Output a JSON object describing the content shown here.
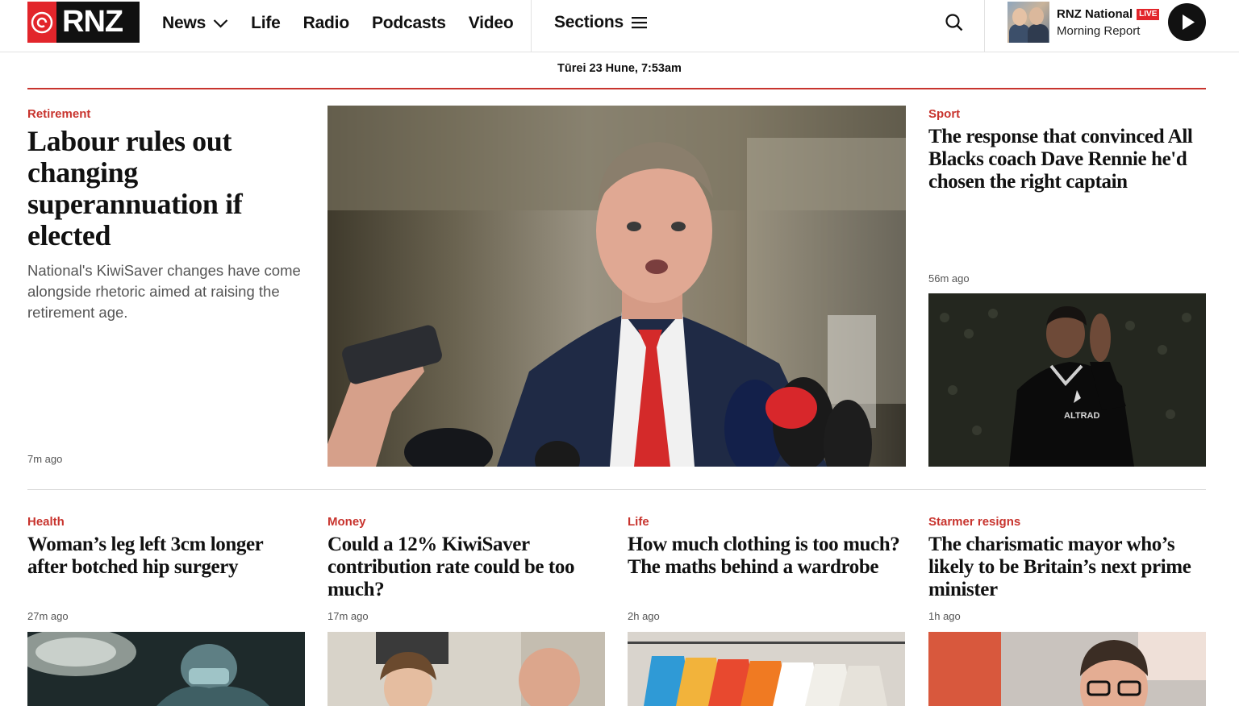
{
  "header": {
    "logo_text": "RNZ",
    "nav": [
      {
        "label": "News"
      },
      {
        "label": "Life"
      },
      {
        "label": "Radio"
      },
      {
        "label": "Podcasts"
      },
      {
        "label": "Video"
      }
    ],
    "sections_label": "Sections",
    "radio": {
      "station": "RNZ National",
      "live_badge": "LIVE",
      "show": "Morning Report"
    }
  },
  "date_line": "Tūrei 23 Hune, 7:53am",
  "lead_story": {
    "category": "Retirement",
    "headline": "Labour rules out changing superannuation if elected",
    "summary": "National's KiwiSaver changes have come alongside rhetoric aimed at raising the retirement age.",
    "time": "7m ago"
  },
  "side_story": {
    "category": "Sport",
    "headline": "The response that convinced All Blacks coach Dave Rennie he'd chosen the right captain",
    "time": "56m ago",
    "jersey_text": "ALTRAD"
  },
  "cards": [
    {
      "category": "Health",
      "headline": "Woman’s leg left 3cm longer after botched hip surgery",
      "time": "27m ago"
    },
    {
      "category": "Money",
      "headline": "Could a 12% KiwiSaver contribution rate could be too much?",
      "time": "17m ago"
    },
    {
      "category": "Life",
      "headline": "How much clothing is too much? The maths behind a wardrobe",
      "time": "2h ago"
    },
    {
      "category": "Starmer resigns",
      "headline": "The charismatic mayor who’s likely to be Britain’s next prime minister",
      "time": "1h ago"
    }
  ],
  "colors": {
    "accent_red": "#c8342e",
    "logo_red": "#e2252b",
    "text": "#111111",
    "muted": "#555555"
  },
  "icons": [
    "rnz-logo-icon",
    "chevron-down-icon",
    "hamburger-menu-icon",
    "search-icon",
    "play-icon"
  ]
}
